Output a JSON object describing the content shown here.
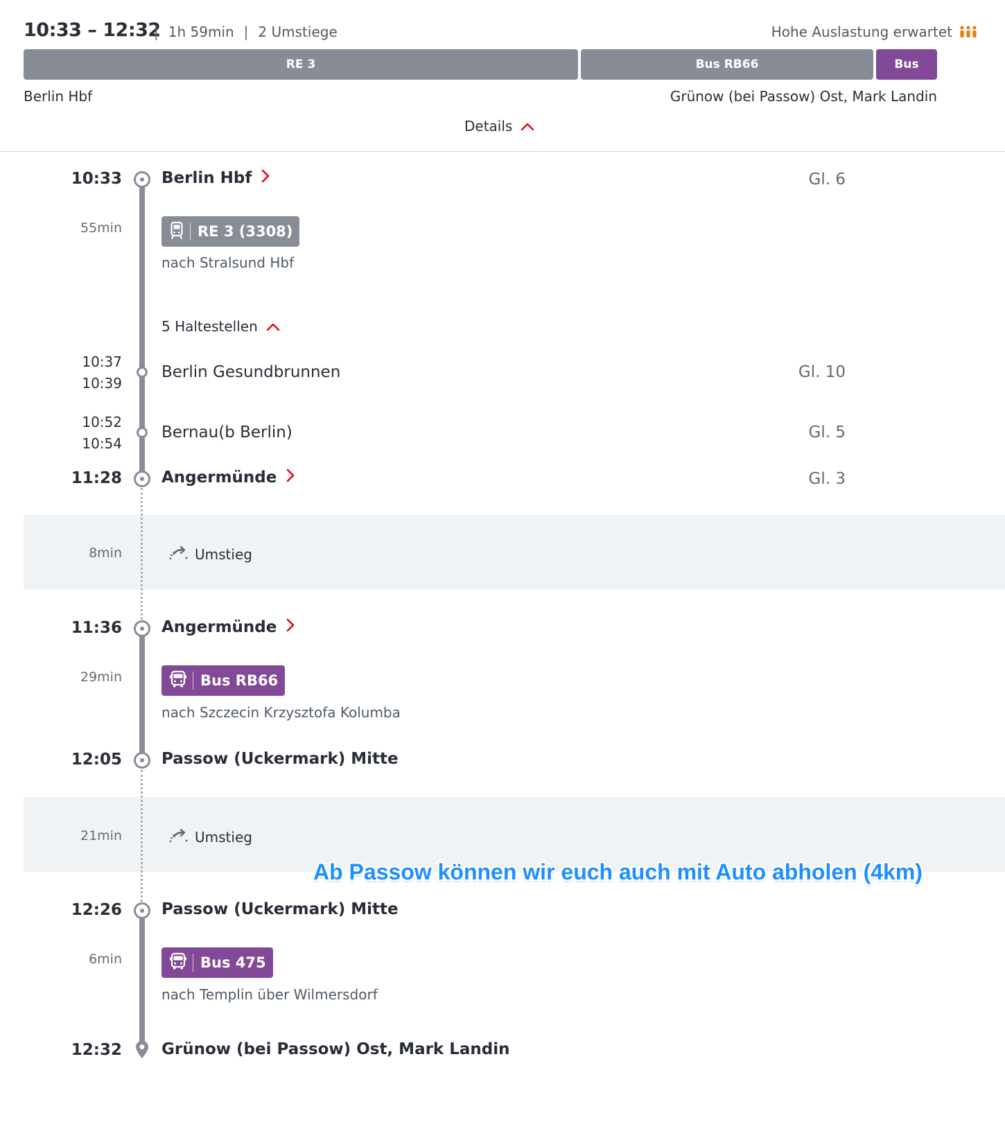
{
  "summary": {
    "times": "10:33 – 12:32",
    "duration": "1h 59min",
    "changes": "2 Umstiege",
    "occupancy": "Hohe Auslastung erwartet",
    "occupancy_icon": "occupancy-high-icon",
    "occupancy_color": "#ec7c0d",
    "segments": [
      {
        "label": "RE 3",
        "color": "#878c96"
      },
      {
        "label": "Bus RB66",
        "color": "#878c96"
      },
      {
        "label": "Bus",
        "color": "#814997"
      }
    ],
    "origin": "Berlin Hbf",
    "destination": "Grünow (bei Passow) Ost, Mark Landin",
    "details_label": "Details",
    "separator": "|"
  },
  "legs": [
    {
      "dep_time": "10:33",
      "dep_station": "Berlin Hbf",
      "dep_track": "Gl. 6",
      "duration": "55min",
      "line": "RE 3 (3308)",
      "line_icon": "train-icon",
      "direction": "nach Stralsund Hbf",
      "stops_toggle": "5 Haltestellen",
      "stops": [
        {
          "arr": "10:37",
          "dep": "10:39",
          "name": "Berlin Gesundbrunnen",
          "track": "Gl. 10"
        },
        {
          "arr": "10:52",
          "dep": "10:54",
          "name": "Bernau(b Berlin)",
          "track": "Gl. 5"
        }
      ],
      "arr_time": "11:28",
      "arr_station": "Angermünde",
      "arr_track": "Gl. 3"
    },
    {
      "dep_time": "11:36",
      "dep_station": "Angermünde",
      "duration": "29min",
      "line": "Bus RB66",
      "line_icon": "bus-icon",
      "direction": "nach Szczecin Krzysztofa Kolumba",
      "arr_time": "12:05",
      "arr_station": "Passow (Uckermark) Mitte"
    },
    {
      "dep_time": "12:26",
      "dep_station": "Passow (Uckermark) Mitte",
      "duration": "6min",
      "line": "Bus 475",
      "line_icon": "bus-icon",
      "direction": "nach Templin über Wilmersdorf",
      "arr_time": "12:32",
      "arr_station": "Grünow (bei Passow) Ost, Mark Landin"
    }
  ],
  "transfers": [
    {
      "duration": "8min",
      "label": "Umstieg"
    },
    {
      "duration": "21min",
      "label": "Umstieg"
    }
  ],
  "annotation": "Ab Passow können wir euch auch mit Auto abholen (4km)",
  "colors": {
    "accent_red": "#ec0016",
    "line_grey": "#878c96",
    "bus_purple": "#814997",
    "annotation_blue": "#1e8fff"
  }
}
